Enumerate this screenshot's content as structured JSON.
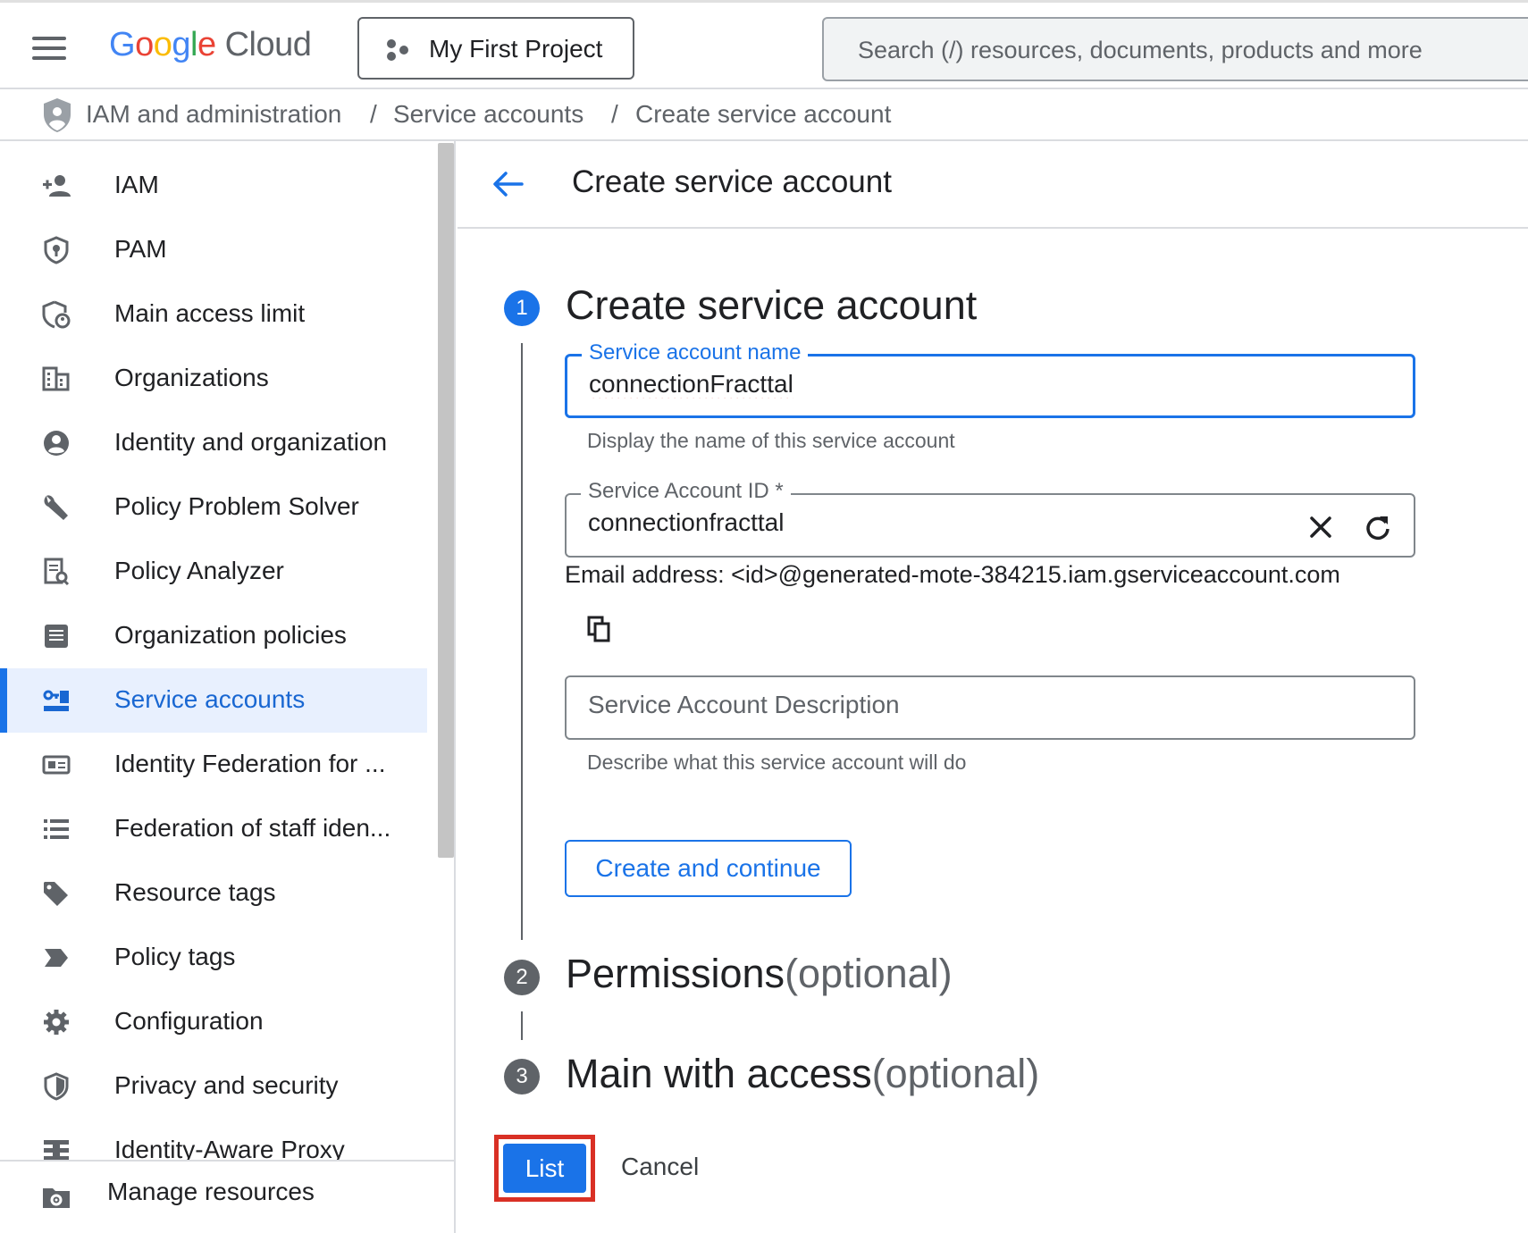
{
  "header": {
    "logo": {
      "google": "Google",
      "cloud": "Cloud",
      "colors": [
        "#4285F4",
        "#EA4335",
        "#FBBC05",
        "#4285F4",
        "#34A853",
        "#EA4335"
      ]
    },
    "project_label": "My First Project",
    "search_placeholder": "Search (/) resources, documents, products and more"
  },
  "breadcrumb": {
    "items": [
      "IAM and administration",
      "Service accounts",
      "Create service account"
    ],
    "separator": "/"
  },
  "sidebar": {
    "items": [
      {
        "label": "IAM",
        "icon": "person-add-icon"
      },
      {
        "label": "PAM",
        "icon": "shield-lock-icon"
      },
      {
        "label": "Main access limit",
        "icon": "shield-person-icon"
      },
      {
        "label": "Organizations",
        "icon": "building-icon"
      },
      {
        "label": "Identity and organization",
        "icon": "account-circle-icon"
      },
      {
        "label": "Policy Problem Solver",
        "icon": "wrench-icon"
      },
      {
        "label": "Policy Analyzer",
        "icon": "document-search-icon"
      },
      {
        "label": "Organization policies",
        "icon": "list-document-icon"
      },
      {
        "label": "Service accounts",
        "icon": "service-account-icon",
        "active": true
      },
      {
        "label": "Identity Federation for ...",
        "icon": "id-card-icon"
      },
      {
        "label": "Federation of staff iden...",
        "icon": "list-icon"
      },
      {
        "label": "Resource tags",
        "icon": "tag-icon"
      },
      {
        "label": "Policy tags",
        "icon": "label-icon"
      },
      {
        "label": "Configuration",
        "icon": "gear-icon"
      },
      {
        "label": "Privacy and security",
        "icon": "shield-icon"
      },
      {
        "label": "Identity-Aware Proxy",
        "icon": "proxy-icon"
      }
    ],
    "footer_label": "Manage resources"
  },
  "main": {
    "title": "Create service account",
    "step1": {
      "number": "1",
      "title": "Create service account",
      "name_field": {
        "label": "Service account name",
        "value": "connectionFracttal",
        "helper": "Display the name of this service account"
      },
      "id_field": {
        "label": "Service Account ID *",
        "value": "connectionfracttal"
      },
      "email_text": "Email address: <id>@generated-mote-384215.iam.gserviceaccount.com",
      "description_field": {
        "placeholder": "Service Account Description",
        "helper": "Describe what this service account will do"
      },
      "continue_label": "Create and continue"
    },
    "step2": {
      "number": "2",
      "title": "Permissions",
      "optional": "(optional)"
    },
    "step3": {
      "number": "3",
      "title": "Main with access",
      "optional": "(optional)"
    },
    "done_label": "List",
    "cancel_label": "Cancel"
  },
  "colors": {
    "accent": "#1a73e8",
    "active_bg": "#e8f0fe",
    "highlight": "#d93025"
  }
}
